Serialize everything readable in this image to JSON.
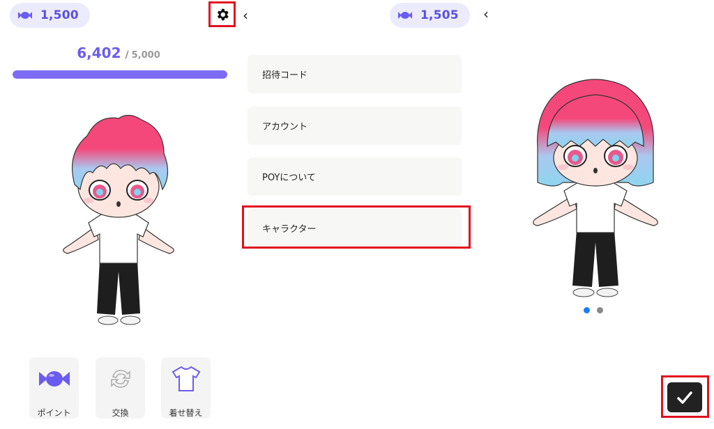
{
  "colors": {
    "accent": "#6a5cf0",
    "highlight": "#e0101f",
    "hair_top": "#f5487a",
    "hair_bottom": "#8fd5ef"
  },
  "screen1": {
    "candy_count": "1,500",
    "score": {
      "current": "6,402",
      "separator": "/",
      "max": "5,000",
      "progress_fraction": 1.0
    },
    "actions": [
      {
        "label": "ポイント",
        "icon": "candy-icon"
      },
      {
        "label": "交換",
        "icon": "exchange-icon"
      },
      {
        "label": "着せ替え",
        "icon": "tshirt-icon"
      }
    ]
  },
  "screen2": {
    "back_glyph": "‹",
    "candy_count": "1,505",
    "menu": [
      {
        "label": "招待コード"
      },
      {
        "label": "アカウント"
      },
      {
        "label": "POYについて"
      },
      {
        "label": "キャラクター"
      }
    ]
  },
  "screen3": {
    "back_glyph": "‹",
    "page_count": 2,
    "active_page": 1
  }
}
